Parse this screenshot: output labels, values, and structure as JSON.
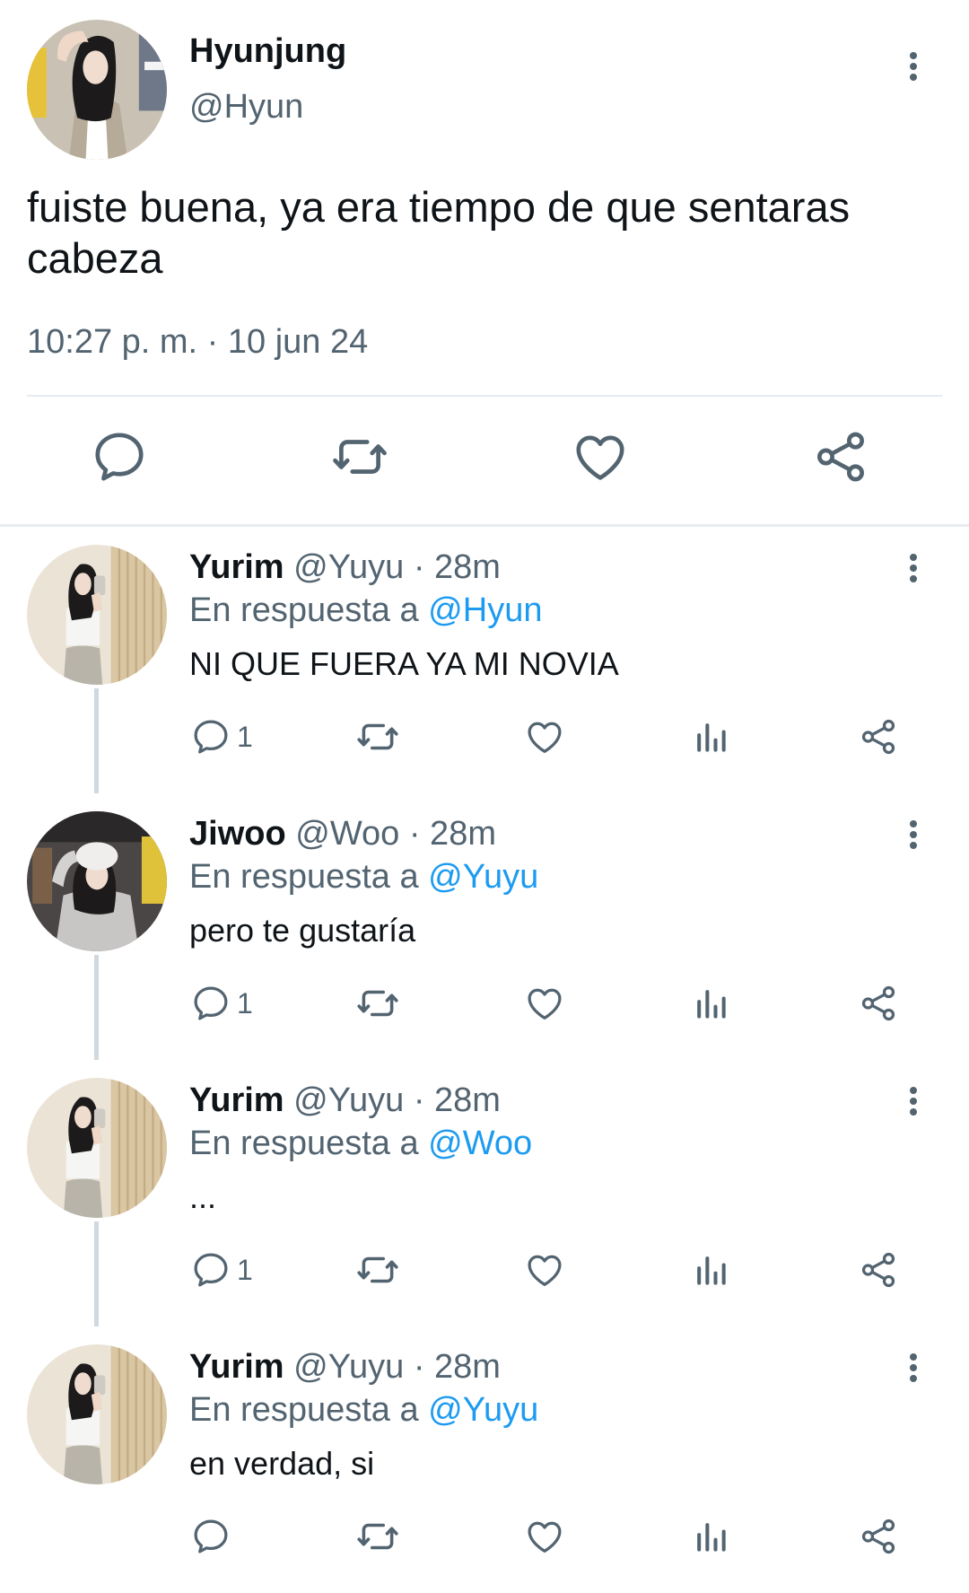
{
  "main_tweet": {
    "display_name": "Hyunjung",
    "handle": "@Hyun",
    "text": "fuiste buena, ya era tiempo de que sentaras cabeza",
    "timestamp": "10:27 p. m. · 10 jun 24",
    "actions": [
      "reply-icon",
      "retweet-icon",
      "like-icon",
      "share-icon"
    ]
  },
  "replies": [
    {
      "name": "Yurim",
      "handle": "@Yuyu",
      "time": "· 28m",
      "replying_prefix": "En respuesta a",
      "replying_to": "@Hyun",
      "text": "NI QUE FUERA YA MI NOVIA",
      "reply_count": "1"
    },
    {
      "name": "Jiwoo",
      "handle": "@Woo",
      "time": "· 28m",
      "replying_prefix": "En respuesta a",
      "replying_to": "@Yuyu",
      "text": "pero te gustaría",
      "reply_count": "1"
    },
    {
      "name": "Yurim",
      "handle": "@Yuyu",
      "time": "· 28m",
      "replying_prefix": "En respuesta a",
      "replying_to": "@Woo",
      "text": "...",
      "reply_count": "1"
    },
    {
      "name": "Yurim",
      "handle": "@Yuyu",
      "time": "· 28m",
      "replying_prefix": "En respuesta a",
      "replying_to": "@Yuyu",
      "text": "en verdad, si",
      "reply_count": ""
    }
  ],
  "colors": {
    "text": "#0f1419",
    "muted": "#536471",
    "mention": "#1d9bf0",
    "divider": "#e6ecf0",
    "icon": "#536471"
  }
}
